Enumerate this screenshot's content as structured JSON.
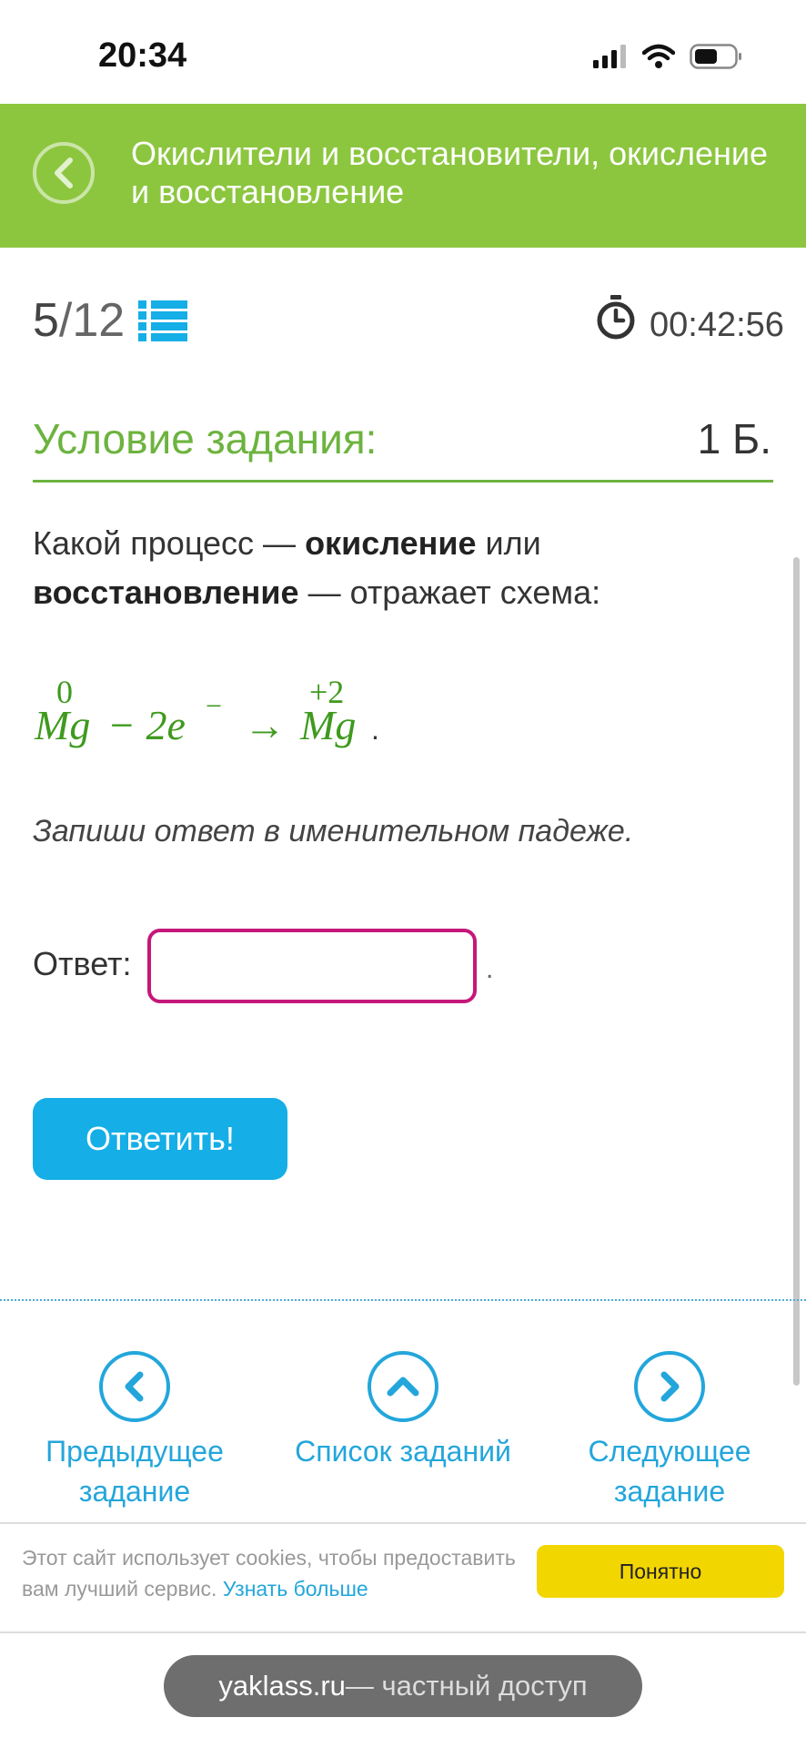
{
  "status_bar": {
    "time": "20:34"
  },
  "header": {
    "title": "Окислители и восстановители, окисление и восстановление"
  },
  "progress": {
    "current": "5",
    "total": "/12"
  },
  "timer": "00:42:56",
  "condition": {
    "title": "Условие задания:",
    "points": "1 Б.",
    "q_part1": "Какой процесс — ",
    "q_bold1": "окисление",
    "q_part2": " или ",
    "q_bold2": "восстановление",
    "q_part3": " — отражает схема:",
    "hint": "Запиши ответ в именительном падеже."
  },
  "formula": {
    "left_charge": "0",
    "left_element": "Mg",
    "electrons": "− 2e",
    "electron_sign": "−",
    "arrow": "→",
    "right_charge": "+2",
    "right_element": "Mg",
    "end": "."
  },
  "answer": {
    "label": "Ответ:",
    "value": "",
    "dot": "."
  },
  "submit_label": "Ответить!",
  "nav": {
    "prev": [
      "Предыдущее",
      "задание"
    ],
    "list": "Список заданий",
    "next": [
      "Следующее",
      "задание"
    ]
  },
  "cookie": {
    "text": "Этот сайт использует cookies, чтобы предоставить вам лучший сервис. ",
    "link": "Узнать больше",
    "button": "Понятно"
  },
  "banner": {
    "site": "yaklass.ru",
    "rest": " — частный доступ"
  },
  "colors": {
    "header_green": "#8cc63f",
    "accent_blue": "#15aee6",
    "input_border": "#c5177a",
    "cookie_yellow": "#f2d600"
  }
}
